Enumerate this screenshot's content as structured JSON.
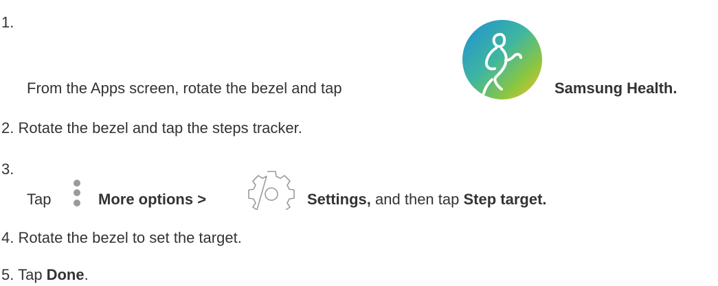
{
  "steps": [
    {
      "number": "1.",
      "text_before": "From the Apps screen, rotate the bezel and tap",
      "icon": "samsung-health-icon",
      "bold": "Samsung Health."
    },
    {
      "number": "2.",
      "text": "Rotate the bezel and tap the steps tracker."
    },
    {
      "number": "3.",
      "text_before": "Tap",
      "icon_1": "more-options-icon",
      "bold_1": "More options >",
      "icon_2": "settings-gear-icon",
      "bold_2": "Settings,",
      "text_middle": "and then tap",
      "bold_3": "Step target."
    },
    {
      "number": "4.",
      "text": "Rotate the bezel to set the target."
    },
    {
      "number": "5.",
      "text_before": "Tap",
      "bold": "Done",
      "text_after": "."
    }
  ],
  "colors": {
    "text": "#333333",
    "icon_gray": "#9a9a9a",
    "health_blue": "#1e8fd4",
    "health_green": "#8cc63f",
    "health_yellow": "#f2c230"
  }
}
